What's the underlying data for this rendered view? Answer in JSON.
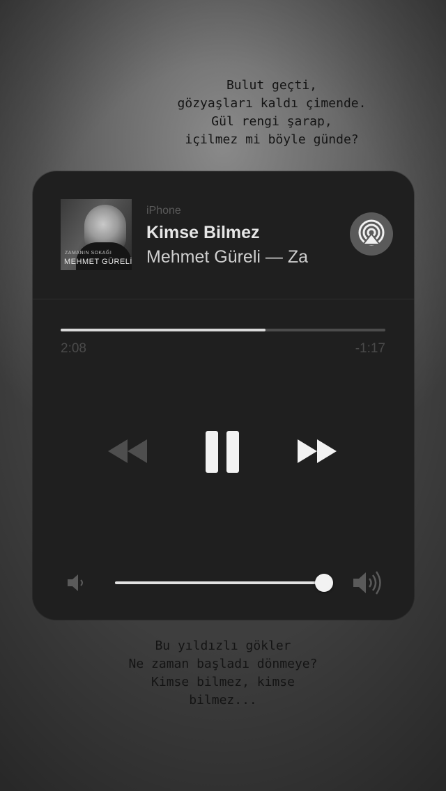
{
  "story_text": {
    "top_lines": [
      "Bulut geçti,",
      "gözyaşları kaldı çimende.",
      "Gül rengi şarap,",
      "içilmez mi böyle günde?"
    ],
    "bottom_lines": [
      "Bu yıldızlı gökler",
      "Ne zaman başladı dönmeye?",
      "Kimse bilmez, kimse",
      "bilmez..."
    ]
  },
  "now_playing": {
    "source": "iPhone",
    "title": "Kimse Bilmez",
    "subtitle": "Mehmet Güreli — Za",
    "album_art": {
      "small_text": "ZAMANIN SOKAĞI",
      "artist_text": "MEHMET GÜRELİ"
    },
    "airplay_icon": "airplay-icon",
    "progress": {
      "fraction": 0.63,
      "elapsed": "2:08",
      "remaining": "-1:17"
    },
    "controls": {
      "rewind_icon": "rewind-icon",
      "pause_icon": "pause-icon",
      "forward_icon": "fast-forward-icon"
    },
    "volume": {
      "fraction": 0.98,
      "low_icon": "speaker-low-icon",
      "high_icon": "speaker-high-icon"
    }
  },
  "colors": {
    "panel": "#1f1f1f",
    "title_text": "#e6e6e6",
    "muted_text": "#4a4a4a",
    "poem_text": "#141414"
  }
}
